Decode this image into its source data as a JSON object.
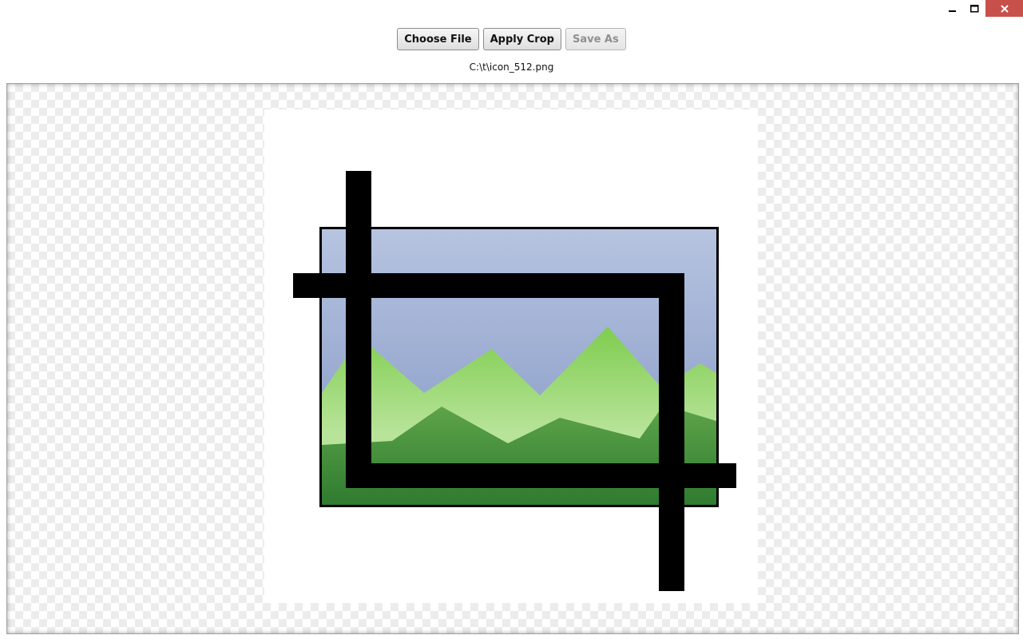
{
  "window": {
    "controls": {
      "minimize_glyph": "–",
      "maximize_glyph": "□",
      "close_glyph": "✕"
    }
  },
  "toolbar": {
    "choose_file_label": "Choose File",
    "apply_crop_label": "Apply Crop",
    "save_as_label": "Save As",
    "save_as_enabled": false
  },
  "file": {
    "path": "C:\\t\\icon_512.png"
  },
  "canvas": {
    "background": "checkerboard",
    "image": {
      "icon": "crop-icon",
      "colors": {
        "sky_top": "#b6c4e0",
        "sky_bottom": "#8396c4",
        "hill_light": "#8ed35b",
        "hill_pale": "#b8e49a",
        "hill_dark": "#378536",
        "crop_marks": "#000000"
      }
    }
  }
}
